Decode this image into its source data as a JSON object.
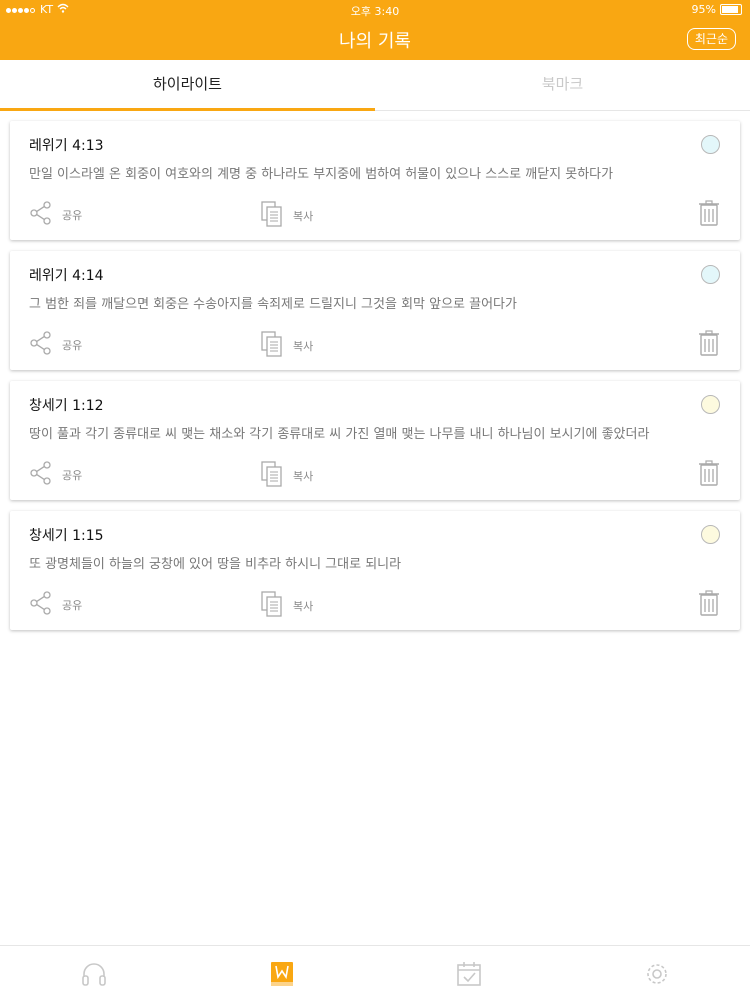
{
  "status_bar": {
    "carrier": "KT",
    "time": "오후 3:40",
    "battery": "95%"
  },
  "header": {
    "title": "나의 기록",
    "sort_label": "최근순"
  },
  "tabs": {
    "highlight": "하이라이트",
    "bookmark": "북마크",
    "active": "highlight"
  },
  "records": [
    {
      "ref": "레위기 4:13",
      "text": "만일 이스라엘 온 회중이 여호와의 계명 중 하나라도 부지중에 범하여 허물이 있으나 스스로 깨닫지 못하다가",
      "color": "#e3f7fa",
      "share_label": "공유",
      "copy_label": "복사"
    },
    {
      "ref": "레위기 4:14",
      "text": "그 범한 죄를 깨달으면 회중은 수송아지를 속죄제로 드릴지니 그것을 회막 앞으로 끌어다가",
      "color": "#e3f7fa",
      "share_label": "공유",
      "copy_label": "복사"
    },
    {
      "ref": "창세기 1:12",
      "text": "땅이 풀과 각기 종류대로 씨 맺는 채소와 각기 종류대로 씨 가진 열매 맺는 나무를 내니 하나님이 보시기에 좋았더라",
      "color": "#fdfadf",
      "share_label": "공유",
      "copy_label": "복사"
    },
    {
      "ref": "창세기 1:15",
      "text": "또 광명체들이 하늘의 궁창에 있어 땅을 비추라 하시니 그대로 되니라",
      "color": "#fdfadf",
      "share_label": "공유",
      "copy_label": "복사"
    }
  ],
  "bottom_tabs": [
    {
      "icon": "headphones-icon"
    },
    {
      "icon": "bookmark-book-icon",
      "active": true
    },
    {
      "icon": "calendar-check-icon"
    },
    {
      "icon": "gear-icon"
    }
  ],
  "colors": {
    "accent": "#f9a712",
    "inactive_icon": "#c8c8c8"
  }
}
